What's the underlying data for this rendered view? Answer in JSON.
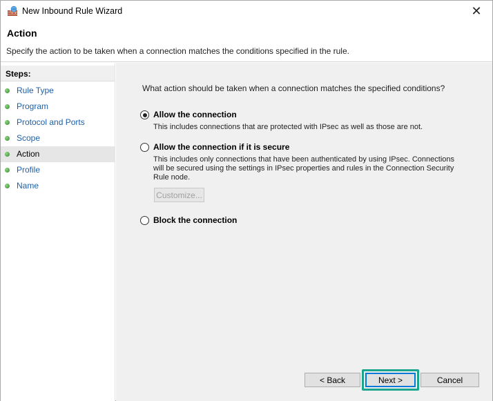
{
  "window": {
    "title": "New Inbound Rule Wizard",
    "close_glyph": "✕"
  },
  "header": {
    "heading": "Action",
    "description": "Specify the action to be taken when a connection matches the conditions specified in the rule."
  },
  "sidebar": {
    "title": "Steps:",
    "items": [
      {
        "label": "Rule Type"
      },
      {
        "label": "Program"
      },
      {
        "label": "Protocol and Ports"
      },
      {
        "label": "Scope"
      },
      {
        "label": "Action"
      },
      {
        "label": "Profile"
      },
      {
        "label": "Name"
      }
    ],
    "active_index": 4
  },
  "main": {
    "question": "What action should be taken when a connection matches the specified conditions?",
    "options": [
      {
        "label": "Allow the connection",
        "note": "This includes connections that are protected with IPsec as well as those are not.",
        "selected": true
      },
      {
        "label": "Allow the connection if it is secure",
        "note": "This includes only connections that have been authenticated by using IPsec.  Connections will be secured using the settings in IPsec properties and rules in the Connection Security Rule node.",
        "selected": false
      },
      {
        "label": "Block the connection",
        "note": "",
        "selected": false
      }
    ],
    "customize_label": "Customize..."
  },
  "footer": {
    "back_label": "< Back",
    "next_label": "Next >",
    "cancel_label": "Cancel"
  },
  "colors": {
    "highlight": "#1aa58f",
    "link": "#1c5fab"
  },
  "icons": {
    "app": "firewall-brick-globe-icon",
    "step": "green-dot-icon"
  }
}
